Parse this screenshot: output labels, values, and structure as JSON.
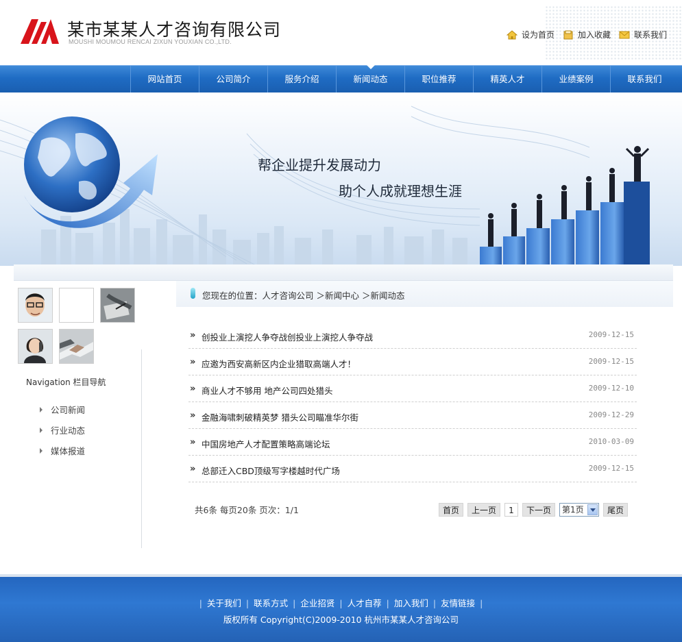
{
  "header": {
    "company_name": "某市某某人才咨询有限公司",
    "company_en": "MOUSHI MOUMOU RENCAI ZIXUN YOUXIAN CO.,LTD.",
    "top_links": [
      {
        "label": "设为首页",
        "icon": "home-icon"
      },
      {
        "label": "加入收藏",
        "icon": "favorite-icon"
      },
      {
        "label": "联系我们",
        "icon": "mail-icon"
      }
    ]
  },
  "nav": {
    "items": [
      "网站首页",
      "公司简介",
      "服务介绍",
      "新闻动态",
      "职位推荐",
      "精英人才",
      "业绩案例",
      "联系我们"
    ],
    "active": "新闻动态"
  },
  "banner": {
    "slogan_line1": "帮企业提升发展动力",
    "slogan_line2": "助个人成就理想生涯"
  },
  "sidebar": {
    "nav_title": "Navigation  栏目导航",
    "links": [
      "公司新闻",
      "行业动态",
      "媒体报道"
    ]
  },
  "breadcrumb": {
    "text": "您现在的位置：人才咨询公司 ＞新闻中心 ＞新闻动态"
  },
  "news": [
    {
      "title": "创投业上演挖人争夺战创投业上演挖人争夺战",
      "date": "2009-12-15"
    },
    {
      "title": "应邀为西安高新区内企业猎取高端人才！",
      "date": "2009-12-15"
    },
    {
      "title": "商业人才不够用  地产公司四处猎头",
      "date": "2009-12-10"
    },
    {
      "title": "金融海啸刺破精英梦  猎头公司瞄准华尔街",
      "date": "2009-12-29"
    },
    {
      "title": "中国房地产人才配置策略高端论坛",
      "date": "2010-03-09"
    },
    {
      "title": "总部迁入CBD顶级写字楼越时代广场",
      "date": "2009-12-15"
    }
  ],
  "pagination": {
    "info": "共6条  每页20条  页次：1/1",
    "first": "首页",
    "prev": "上一页",
    "current": "1",
    "next": "下一页",
    "select_value": "第1页",
    "last": "尾页"
  },
  "footer": {
    "links": [
      "关于我们",
      "联系方式",
      "企业招贤",
      "人才自荐",
      "加入我们",
      "友情链接"
    ],
    "copyright": "版权所有  Copyright(C)2009-2010 杭州市某某人才咨询公司"
  },
  "colors": {
    "nav_blue": "#1f6cc4",
    "footer_blue": "#2f78d2",
    "logo_red": "#d8141b"
  }
}
